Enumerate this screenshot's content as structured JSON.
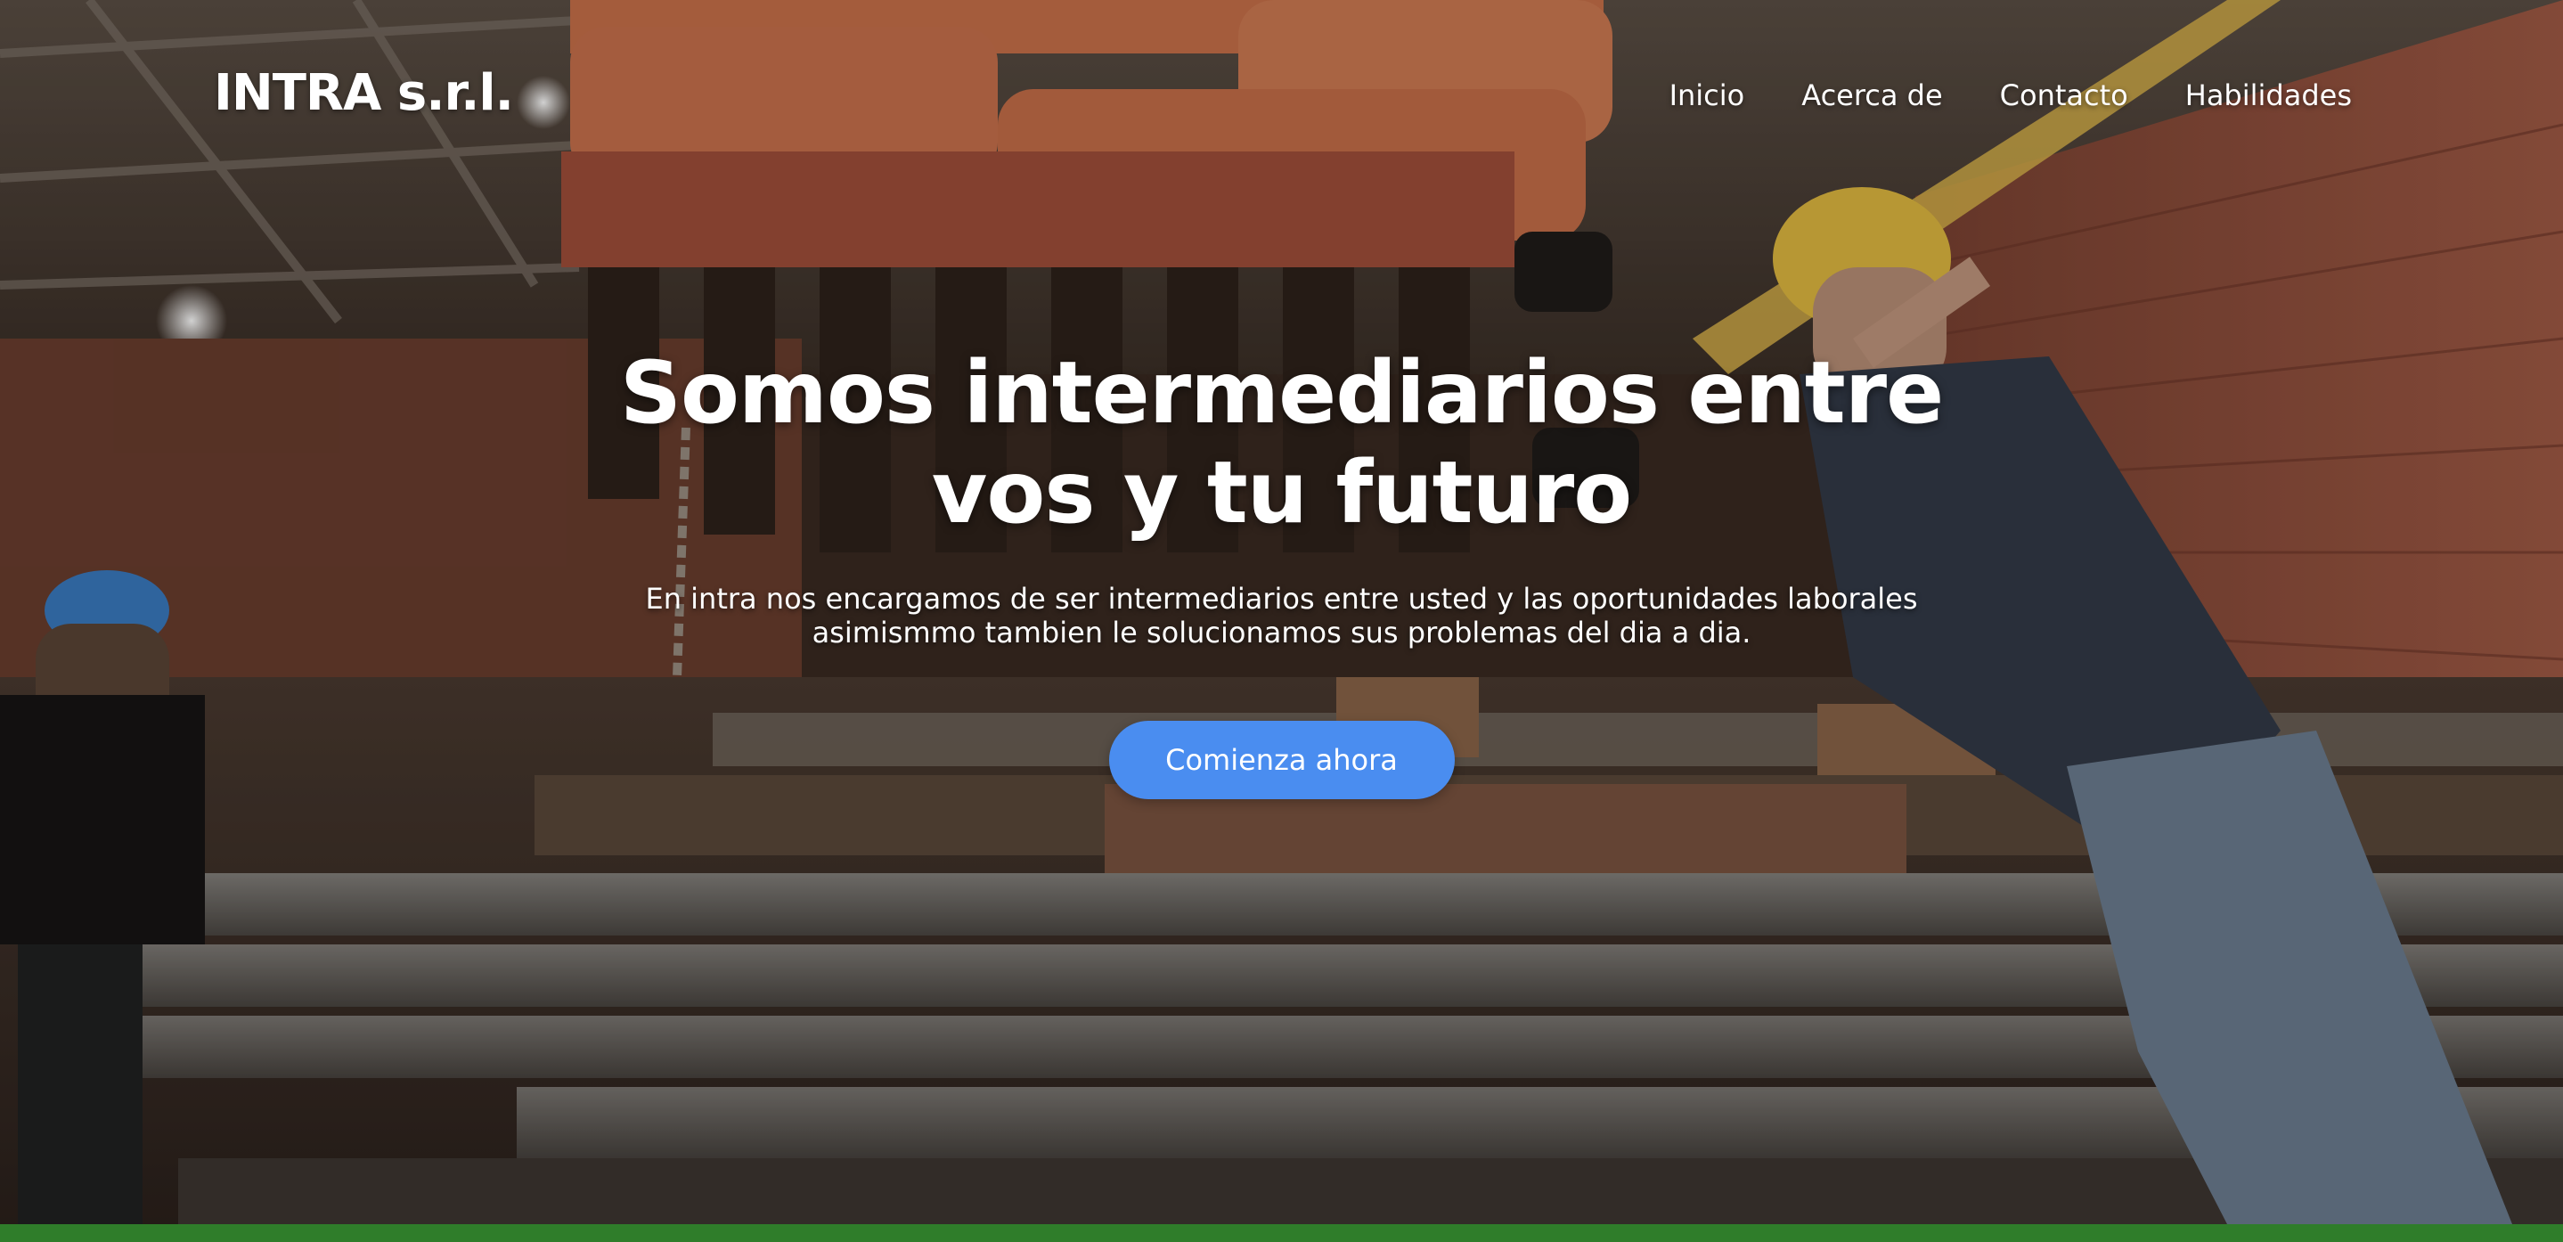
{
  "header": {
    "logo": "INTRA s.r.l.",
    "nav": [
      {
        "label": "Inicio"
      },
      {
        "label": "Acerca de"
      },
      {
        "label": "Contacto"
      },
      {
        "label": "Habilidades"
      }
    ]
  },
  "hero": {
    "title": "Somos intermediarios entre vos y tu futuro",
    "subtitle": "En intra nos encargamos de ser intermediarios entre usted y las oportunidades laborales asimismmo tambien le solucionamos sus problemas del dia a dia.",
    "cta_label": "Comienza ahora",
    "background_image": "warehouse-workers-photo"
  },
  "colors": {
    "accent": "#4a8df0",
    "bottom_bar": "#2f7d2a",
    "text": "#ffffff"
  }
}
